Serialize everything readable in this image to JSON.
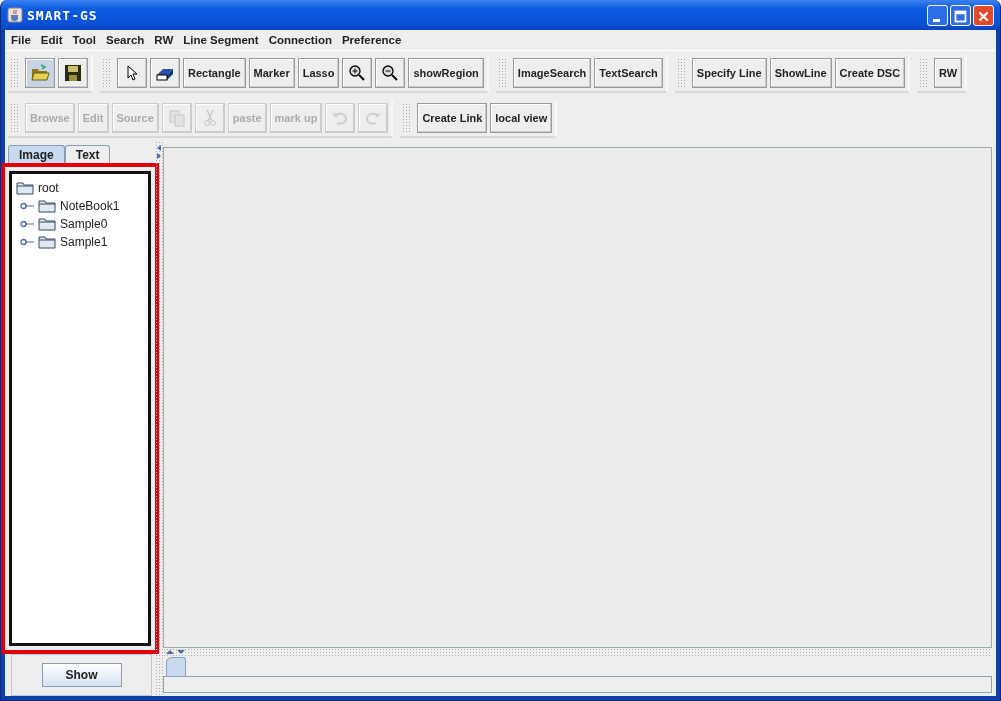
{
  "window": {
    "title": "SMART-GS"
  },
  "menu": [
    "File",
    "Edit",
    "Tool",
    "Search",
    "RW",
    "Line Segment",
    "Connection",
    "Preference"
  ],
  "toolbar_rows": [
    [
      [
        {
          "kind": "open",
          "disabled": false,
          "selected": true
        },
        {
          "kind": "save",
          "disabled": false,
          "selected": false
        }
      ],
      [
        {
          "kind": "pointer",
          "disabled": false,
          "selected": false
        },
        {
          "kind": "eraser",
          "disabled": false,
          "selected": false
        },
        {
          "kind": "text",
          "label": "Rectangle",
          "disabled": false,
          "selected": false
        },
        {
          "kind": "text",
          "label": "Marker",
          "disabled": false,
          "selected": false
        },
        {
          "kind": "text",
          "label": "Lasso",
          "disabled": false,
          "selected": false
        },
        {
          "kind": "zoomin",
          "disabled": false,
          "selected": false
        },
        {
          "kind": "zoomout",
          "disabled": false,
          "selected": false
        },
        {
          "kind": "text",
          "label": "showRegion",
          "disabled": false,
          "selected": false
        }
      ],
      [
        {
          "kind": "text",
          "label": "ImageSearch",
          "disabled": false,
          "selected": false
        },
        {
          "kind": "text",
          "label": "TextSearch",
          "disabled": false,
          "selected": false
        }
      ],
      [
        {
          "kind": "text",
          "label": "Specify Line",
          "disabled": false,
          "selected": false
        },
        {
          "kind": "text",
          "label": "ShowLine",
          "disabled": false,
          "selected": false
        },
        {
          "kind": "text",
          "label": "Create DSC",
          "disabled": false,
          "selected": false
        }
      ],
      [
        {
          "kind": "text",
          "label": "RW",
          "disabled": false,
          "selected": false
        }
      ]
    ],
    [
      [
        {
          "kind": "text",
          "label": "Browse",
          "disabled": true,
          "selected": false
        },
        {
          "kind": "text",
          "label": "Edit",
          "disabled": true,
          "selected": false
        },
        {
          "kind": "text",
          "label": "Source",
          "disabled": true,
          "selected": false
        },
        {
          "kind": "copy",
          "disabled": true,
          "selected": false
        },
        {
          "kind": "cut",
          "disabled": true,
          "selected": false
        },
        {
          "kind": "text",
          "label": "paste",
          "disabled": true,
          "selected": false
        },
        {
          "kind": "text",
          "label": "mark up",
          "disabled": true,
          "selected": false
        },
        {
          "kind": "undo",
          "disabled": true,
          "selected": false
        },
        {
          "kind": "redo",
          "disabled": true,
          "selected": false
        }
      ],
      [
        {
          "kind": "text",
          "label": "Create Link",
          "disabled": false,
          "selected": false
        },
        {
          "kind": "text",
          "label": "local view",
          "disabled": false,
          "selected": false
        }
      ]
    ]
  ],
  "side_tabs": [
    {
      "label": "Image",
      "selected": true
    },
    {
      "label": "Text",
      "selected": false
    }
  ],
  "tree": {
    "highlighted": true,
    "label": "root",
    "children": [
      {
        "label": "NoteBook1",
        "expanded": false
      },
      {
        "label": "Sample0",
        "expanded": false
      },
      {
        "label": "Sample1",
        "expanded": false
      }
    ]
  },
  "show_button": "Show"
}
